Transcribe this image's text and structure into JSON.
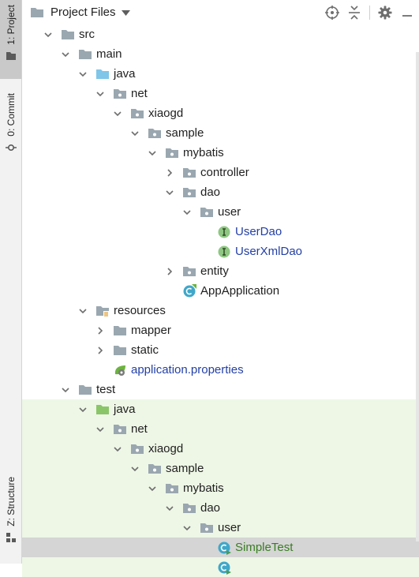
{
  "tool_strip": {
    "project_tab": "1: Project",
    "commit_tab": "0: Commit",
    "structure_tab": "Z: Structure"
  },
  "header": {
    "title": "Project Files"
  },
  "tree": [
    {
      "label": "src",
      "depth": 0,
      "expanded": true,
      "icon": "folder-icon",
      "color": "normal",
      "test": false
    },
    {
      "label": "main",
      "depth": 1,
      "expanded": true,
      "icon": "folder-icon",
      "color": "normal",
      "test": false
    },
    {
      "label": "java",
      "depth": 2,
      "expanded": true,
      "icon": "source-folder-icon",
      "color": "normal",
      "test": false
    },
    {
      "label": "net",
      "depth": 3,
      "expanded": true,
      "icon": "package-icon",
      "color": "normal",
      "test": false
    },
    {
      "label": "xiaogd",
      "depth": 4,
      "expanded": true,
      "icon": "package-icon",
      "color": "normal",
      "test": false
    },
    {
      "label": "sample",
      "depth": 5,
      "expanded": true,
      "icon": "package-icon",
      "color": "normal",
      "test": false
    },
    {
      "label": "mybatis",
      "depth": 6,
      "expanded": true,
      "icon": "package-icon",
      "color": "normal",
      "test": false
    },
    {
      "label": "controller",
      "depth": 7,
      "expanded": false,
      "icon": "package-icon",
      "color": "normal",
      "test": false
    },
    {
      "label": "dao",
      "depth": 7,
      "expanded": true,
      "icon": "package-icon",
      "color": "normal",
      "test": false
    },
    {
      "label": "user",
      "depth": 8,
      "expanded": true,
      "icon": "package-icon",
      "color": "normal",
      "test": false
    },
    {
      "label": "UserDao",
      "depth": 9,
      "expanded": null,
      "icon": "interface-icon",
      "color": "blue",
      "test": false
    },
    {
      "label": "UserXmlDao",
      "depth": 9,
      "expanded": null,
      "icon": "interface-icon",
      "color": "blue",
      "test": false
    },
    {
      "label": "entity",
      "depth": 7,
      "expanded": false,
      "icon": "package-icon",
      "color": "normal",
      "test": false
    },
    {
      "label": "AppApplication",
      "depth": 7,
      "expanded": null,
      "icon": "spring-class-icon",
      "color": "normal",
      "test": false
    },
    {
      "label": "resources",
      "depth": 2,
      "expanded": true,
      "icon": "resources-folder-icon",
      "color": "normal",
      "test": false
    },
    {
      "label": "mapper",
      "depth": 3,
      "expanded": false,
      "icon": "folder-icon",
      "color": "normal",
      "test": false
    },
    {
      "label": "static",
      "depth": 3,
      "expanded": false,
      "icon": "folder-icon",
      "color": "normal",
      "test": false
    },
    {
      "label": "application.properties",
      "depth": 3,
      "expanded": null,
      "icon": "spring-properties-icon",
      "color": "blue",
      "test": false
    },
    {
      "label": "test",
      "depth": 1,
      "expanded": true,
      "icon": "folder-icon",
      "color": "normal",
      "test": false
    },
    {
      "label": "java",
      "depth": 2,
      "expanded": true,
      "icon": "test-source-folder-icon",
      "color": "normal",
      "test": true
    },
    {
      "label": "net",
      "depth": 3,
      "expanded": true,
      "icon": "package-icon",
      "color": "normal",
      "test": true
    },
    {
      "label": "xiaogd",
      "depth": 4,
      "expanded": true,
      "icon": "package-icon",
      "color": "normal",
      "test": true
    },
    {
      "label": "sample",
      "depth": 5,
      "expanded": true,
      "icon": "package-icon",
      "color": "normal",
      "test": true
    },
    {
      "label": "mybatis",
      "depth": 6,
      "expanded": true,
      "icon": "package-icon",
      "color": "normal",
      "test": true
    },
    {
      "label": "dao",
      "depth": 7,
      "expanded": true,
      "icon": "package-icon",
      "color": "normal",
      "test": true
    },
    {
      "label": "user",
      "depth": 8,
      "expanded": true,
      "icon": "package-icon",
      "color": "normal",
      "test": true
    },
    {
      "label": "SimpleTest",
      "depth": 9,
      "expanded": null,
      "icon": "test-class-icon",
      "color": "green",
      "test": true,
      "selected": true
    },
    {
      "label": "",
      "depth": 9,
      "expanded": null,
      "icon": "test-class-icon",
      "color": "green",
      "test": true
    }
  ],
  "colors": {
    "folder": "#9aa7b0",
    "source_folder": "#7fc6e8",
    "test_folder": "#8bc56a",
    "interface_badge": "#8fc783",
    "class_badge": "#40a7c9",
    "label_blue": "#2340a6",
    "label_green": "#3a7d23",
    "test_row_bg": "#eef7e6",
    "selected_row_bg": "#d5d5d5"
  }
}
